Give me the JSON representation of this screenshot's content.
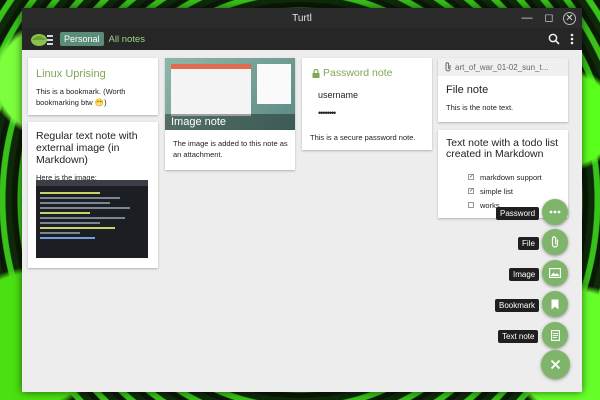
{
  "window": {
    "title": "Turtl"
  },
  "appbar": {
    "space_chip": "Personal",
    "breadcrumb": "All notes"
  },
  "notes": {
    "bookmark": {
      "title": "Linux Uprising",
      "body": "This is a bookmark. (Worth bookmarking btw 😁)"
    },
    "regular": {
      "title": "Regular text note with external image (in Markdown)",
      "body": "Here is the image:"
    },
    "image": {
      "overlay_title": "Image note",
      "body": "The image is added to this note as an attachment."
    },
    "password": {
      "title": "Password note",
      "username": "username",
      "password": "••••••••",
      "body": "This is a secure password note."
    },
    "file": {
      "filename": "art_of_war_01-02_sun_t...",
      "title": "File note",
      "body": "This is the note text."
    },
    "todo": {
      "title": "Text note with a todo list created in Markdown",
      "items": [
        {
          "label": "markdown support",
          "checked": true
        },
        {
          "label": "simple list",
          "checked": true
        },
        {
          "label": "works",
          "checked": false
        }
      ]
    }
  },
  "fab_menu": {
    "password": "Password",
    "file": "File",
    "image": "Image",
    "bookmark": "Bookmark",
    "text_note": "Text note"
  },
  "colors": {
    "accent": "#7fb56a",
    "chip": "#5a8c7a",
    "crumb": "#9bd486"
  }
}
